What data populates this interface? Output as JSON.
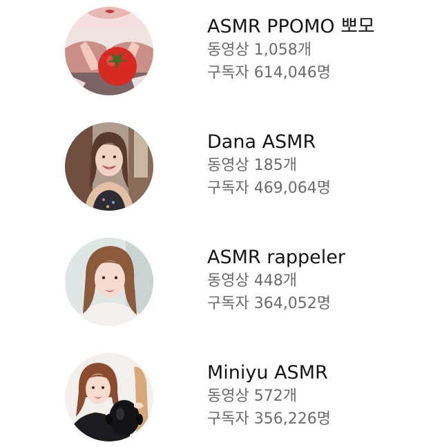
{
  "labels": {
    "videos": "동영상",
    "subscribers": "구독자"
  },
  "channels": [
    {
      "name": "ASMR PPOMO 뽀모",
      "videos": "1,058개",
      "subscribers": "614,046명",
      "avatar": "tomato-hands-avatar"
    },
    {
      "name": "Dana ASMR",
      "videos": "185개",
      "subscribers": "469,064명",
      "avatar": "smiling-woman-avatar"
    },
    {
      "name": "ASMR rappeler",
      "videos": "448개",
      "subscribers": "364,052명",
      "avatar": "woman-portrait-avatar"
    },
    {
      "name": "Miniyu ASMR",
      "videos": "572개",
      "subscribers": "356,226명",
      "avatar": "woman-with-binaural-mic-avatar"
    }
  ],
  "colors": {
    "name_text": "#141414",
    "stat_text": "#6b6b6b",
    "background": "#ffffff"
  }
}
